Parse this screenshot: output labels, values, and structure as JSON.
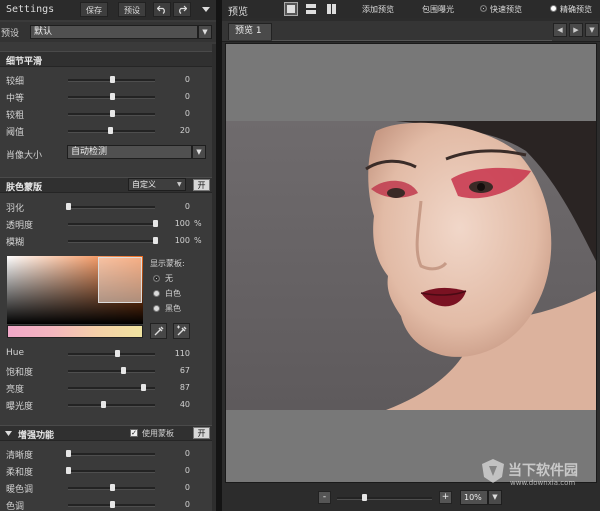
{
  "left": {
    "header": {
      "title": "Settings",
      "save": "保存",
      "preset": "预设"
    },
    "preset_row": {
      "label": "预设",
      "value": "默认"
    },
    "detail": {
      "title": "细节平滑",
      "sliders": [
        {
          "label": "较细",
          "value": "0",
          "pos": 0.5
        },
        {
          "label": "中等",
          "value": "0",
          "pos": 0.5
        },
        {
          "label": "较粗",
          "value": "0",
          "pos": 0.5
        },
        {
          "label": "阈值",
          "value": "20",
          "pos": 0.48
        }
      ],
      "portrait": {
        "label": "肖像大小",
        "value": "自动检测"
      }
    },
    "skin": {
      "title": "肤色蒙版",
      "mode": "自定义",
      "on_button": "开",
      "sliders": [
        {
          "label": "羽化",
          "value": "0",
          "unit": "",
          "pos": 0.0
        },
        {
          "label": "透明度",
          "value": "100",
          "unit": "%",
          "pos": 1.0
        },
        {
          "label": "模糊",
          "value": "100",
          "unit": "%",
          "pos": 1.0
        }
      ],
      "show_mask": {
        "title": "显示蒙板:",
        "options": [
          {
            "label": "无",
            "selected": true
          },
          {
            "label": "白色",
            "selected": false
          },
          {
            "label": "黑色",
            "selected": false
          }
        ]
      },
      "hsl": [
        {
          "label": "Hue",
          "value": "110",
          "pos": 0.56
        },
        {
          "label": "饱和度",
          "value": "67",
          "pos": 0.63
        },
        {
          "label": "亮度",
          "value": "87",
          "pos": 0.86
        },
        {
          "label": "曝光度",
          "value": "40",
          "pos": 0.4
        }
      ]
    },
    "enhance": {
      "title": "增强功能",
      "use_mask": "使用蒙板",
      "on_button": "开",
      "sliders": [
        {
          "label": "清晰度",
          "value": "0",
          "pos": 0.0
        },
        {
          "label": "柔和度",
          "value": "0",
          "pos": 0.0
        },
        {
          "label": "暖色调",
          "value": "0",
          "pos": 0.5
        },
        {
          "label": "色调",
          "value": "0",
          "pos": 0.5
        }
      ]
    }
  },
  "right": {
    "toolbar": {
      "title": "预览",
      "add_preview": "添加预览",
      "crop_exposure": "包围曝光",
      "quick_preview": "快速预览",
      "accurate_preview": "精确预览"
    },
    "tab": {
      "label": "预览 1"
    },
    "bottom": {
      "zoom": "10%",
      "zoom_out": "-",
      "zoom_in": "+",
      "zoom_pos": 0.05
    },
    "watermark": {
      "cn": "当下软件园",
      "url": "www.downxia.com"
    }
  },
  "colors": {
    "panel_bg": "#3a3a3a",
    "preview_bg": "#787878",
    "photo_bg": "#6a6668",
    "accent_orange": "#ef6b1e"
  }
}
